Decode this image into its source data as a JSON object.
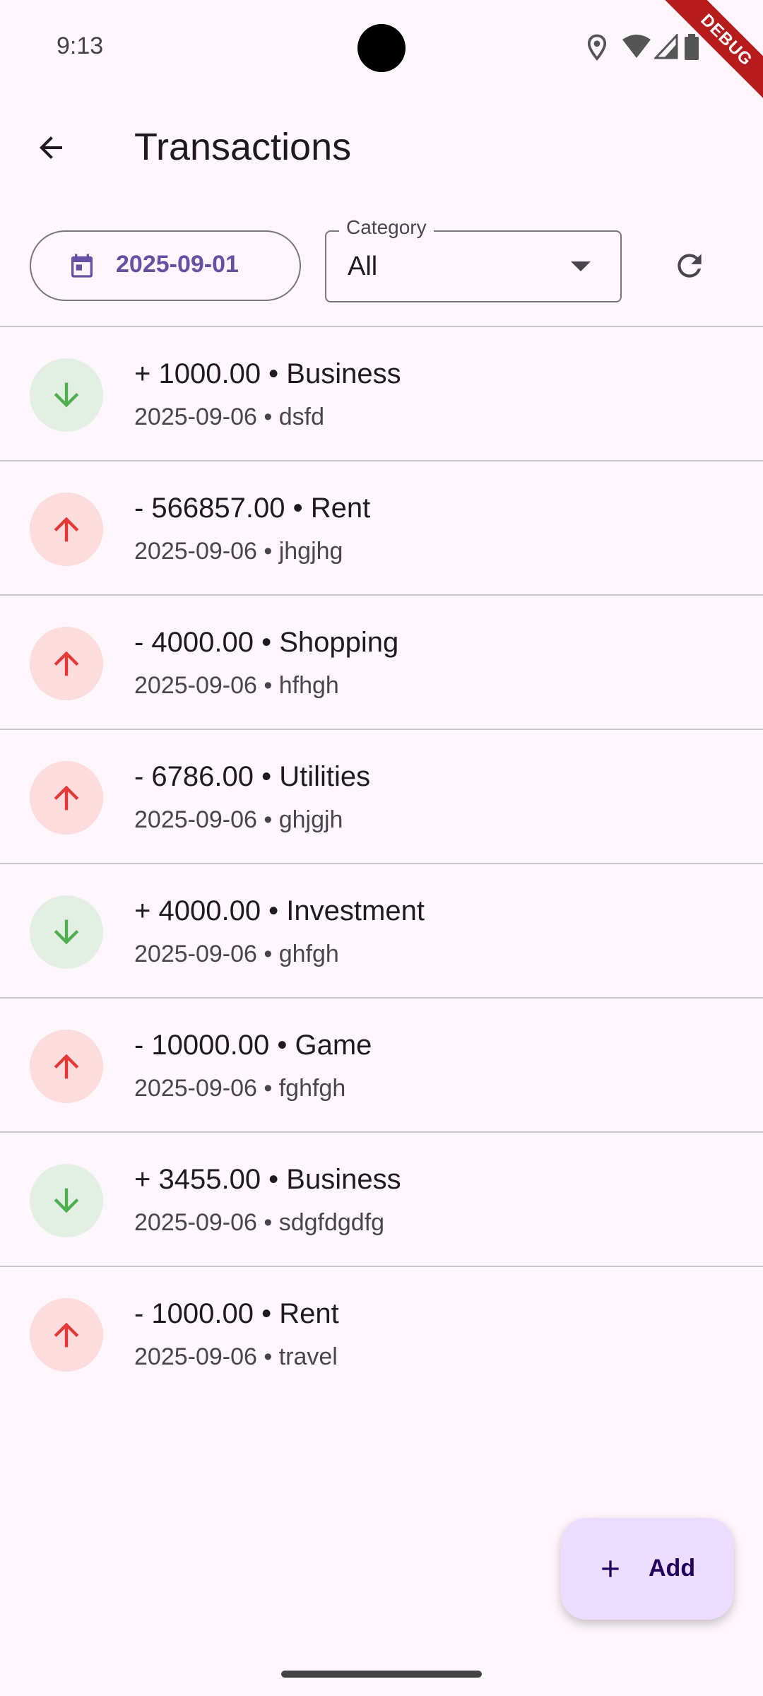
{
  "status_bar": {
    "time": "9:13"
  },
  "debug_banner": {
    "label": "DEBUG"
  },
  "app_bar": {
    "title": "Transactions"
  },
  "filters": {
    "date": "2025-09-01",
    "category_label": "Category",
    "category_value": "All"
  },
  "transactions": [
    {
      "type": "income",
      "title": "+ 1000.00 • Business",
      "subtitle": "2025-09-06  •  dsfd"
    },
    {
      "type": "expense",
      "title": "- 566857.00 • Rent",
      "subtitle": "2025-09-06  •  jhgjhg"
    },
    {
      "type": "expense",
      "title": "- 4000.00 • Shopping",
      "subtitle": "2025-09-06  •  hfhgh"
    },
    {
      "type": "expense",
      "title": "- 6786.00 • Utilities",
      "subtitle": "2025-09-06  •  ghjgjh"
    },
    {
      "type": "income",
      "title": "+ 4000.00 • Investment",
      "subtitle": "2025-09-06  •  ghfgh"
    },
    {
      "type": "expense",
      "title": "- 10000.00 • Game",
      "subtitle": "2025-09-06  •  fghfgh"
    },
    {
      "type": "income",
      "title": "+ 3455.00 • Business",
      "subtitle": "2025-09-06  •  sdgfdgdfg"
    },
    {
      "type": "expense",
      "title": "- 1000.00 • Rent",
      "subtitle": "2025-09-06  •  travel"
    }
  ],
  "fab": {
    "label": "Add"
  },
  "colors": {
    "income_arrow": "#4caf50",
    "expense_arrow": "#e53935",
    "accent": "#6750a4"
  }
}
